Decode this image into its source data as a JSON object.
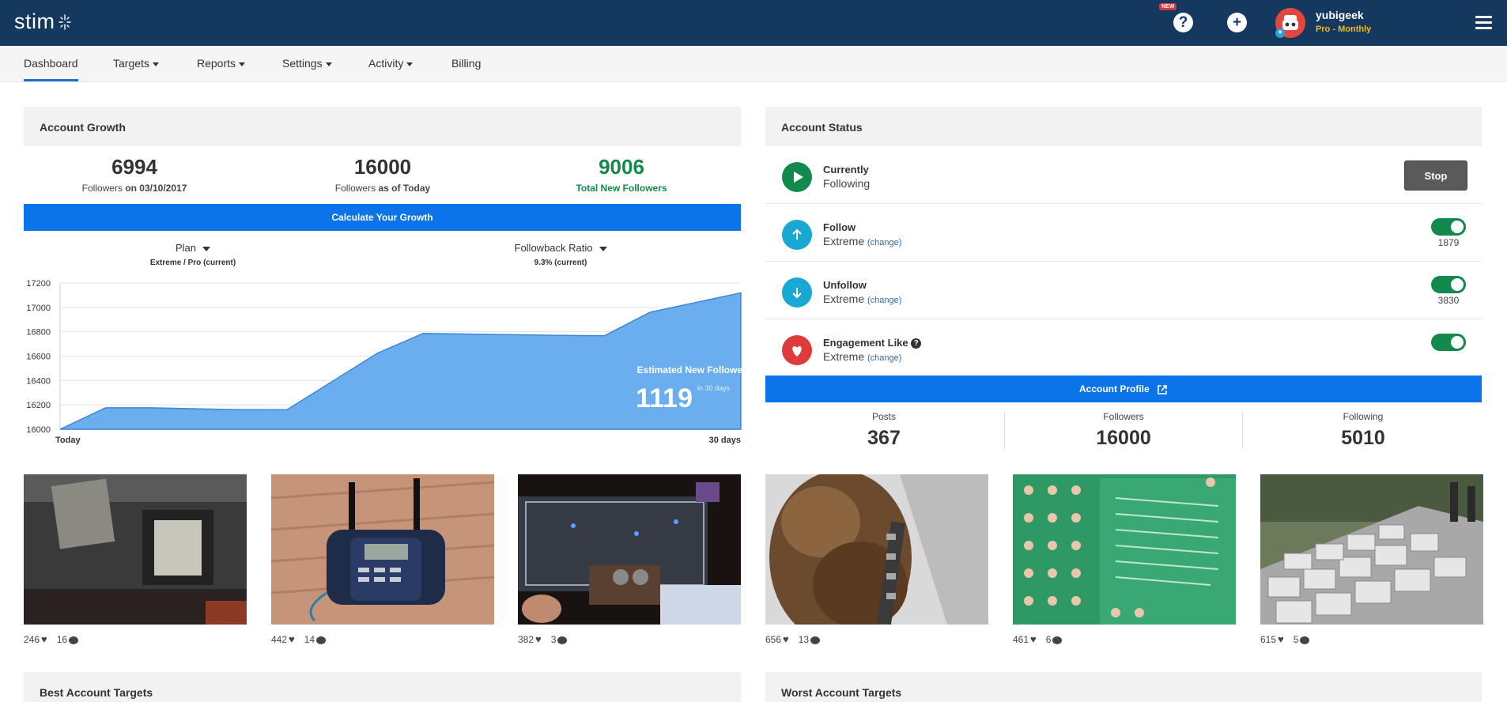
{
  "brand": {
    "name": "stim"
  },
  "topbar": {
    "new_badge": "NEW",
    "help_icon": "question-circle-icon",
    "add_icon": "plus-circle-icon",
    "username": "yubigeek",
    "plan": "Pro - Monthly",
    "menu_icon": "hamburger-icon"
  },
  "nav": {
    "items": [
      {
        "label": "Dashboard",
        "active": true,
        "dropdown": false
      },
      {
        "label": "Targets",
        "dropdown": true
      },
      {
        "label": "Reports",
        "dropdown": true
      },
      {
        "label": "Settings",
        "dropdown": true
      },
      {
        "label": "Activity",
        "dropdown": true
      },
      {
        "label": "Billing",
        "dropdown": false
      }
    ]
  },
  "growth": {
    "title": "Account Growth",
    "stats": [
      {
        "value": "6994",
        "label_plain": "Followers ",
        "label_bold": "on 03/10/2017"
      },
      {
        "value": "16000",
        "label_plain": "Followers ",
        "label_bold": "as of Today"
      },
      {
        "value": "9006",
        "label_bold": "Total New Followers",
        "color": "#128a4d"
      }
    ],
    "calculate_button": "Calculate Your Growth",
    "plan_dropdown": {
      "label": "Plan",
      "value": "Extreme / Pro (current)"
    },
    "ratio_dropdown": {
      "label": "Followback Ratio",
      "value": "9.3% (current)"
    },
    "estimate_label": "Estimated New Followers",
    "estimate_value": "1119",
    "estimate_suffix": "in 30 days"
  },
  "chart_data": {
    "type": "area",
    "x_labels": [
      "Today",
      "30 days"
    ],
    "y_ticks": [
      16000,
      16200,
      16400,
      16600,
      16800,
      17000,
      17200
    ],
    "ylim": [
      16000,
      17200
    ],
    "x": [
      0,
      2,
      4,
      8,
      10,
      14,
      16,
      20,
      22,
      24,
      26,
      28,
      30
    ],
    "values": [
      16000,
      16176,
      16176,
      16160,
      16160,
      16626,
      16786,
      16776,
      16770,
      16768,
      16960,
      17040,
      17119
    ],
    "grid": true,
    "color": "#5fa8ef"
  },
  "status": {
    "title": "Account Status",
    "rows": [
      {
        "title": "Currently",
        "sub": "Following",
        "icon": "play-icon",
        "color": "#128a4d",
        "button": "Stop"
      },
      {
        "title": "Follow",
        "sub": "Extreme",
        "change": "(change)",
        "icon": "arrow-up-icon",
        "color": "#19a7d4",
        "count": "1879"
      },
      {
        "title": "Unfollow",
        "sub": "Extreme",
        "change": "(change)",
        "icon": "arrow-down-icon",
        "color": "#19a7d4",
        "count": "3830"
      },
      {
        "title": "Engagement Like",
        "sub": "Extreme",
        "change": "(change)",
        "icon": "heart-icon",
        "color": "#df3b3b"
      }
    ],
    "profile_button": "Account Profile",
    "profile_stats": [
      {
        "label": "Posts",
        "value": "367"
      },
      {
        "label": "Followers",
        "value": "16000"
      },
      {
        "label": "Following",
        "value": "5010"
      }
    ]
  },
  "photos": [
    {
      "likes": "246",
      "comments": "16"
    },
    {
      "likes": "442",
      "comments": "14"
    },
    {
      "likes": "382",
      "comments": "3"
    },
    {
      "likes": "656",
      "comments": "13"
    },
    {
      "likes": "461",
      "comments": "6"
    },
    {
      "likes": "615",
      "comments": "5"
    }
  ],
  "bottom": {
    "best_title": "Best Account Targets",
    "worst_title": "Worst Account Targets"
  }
}
